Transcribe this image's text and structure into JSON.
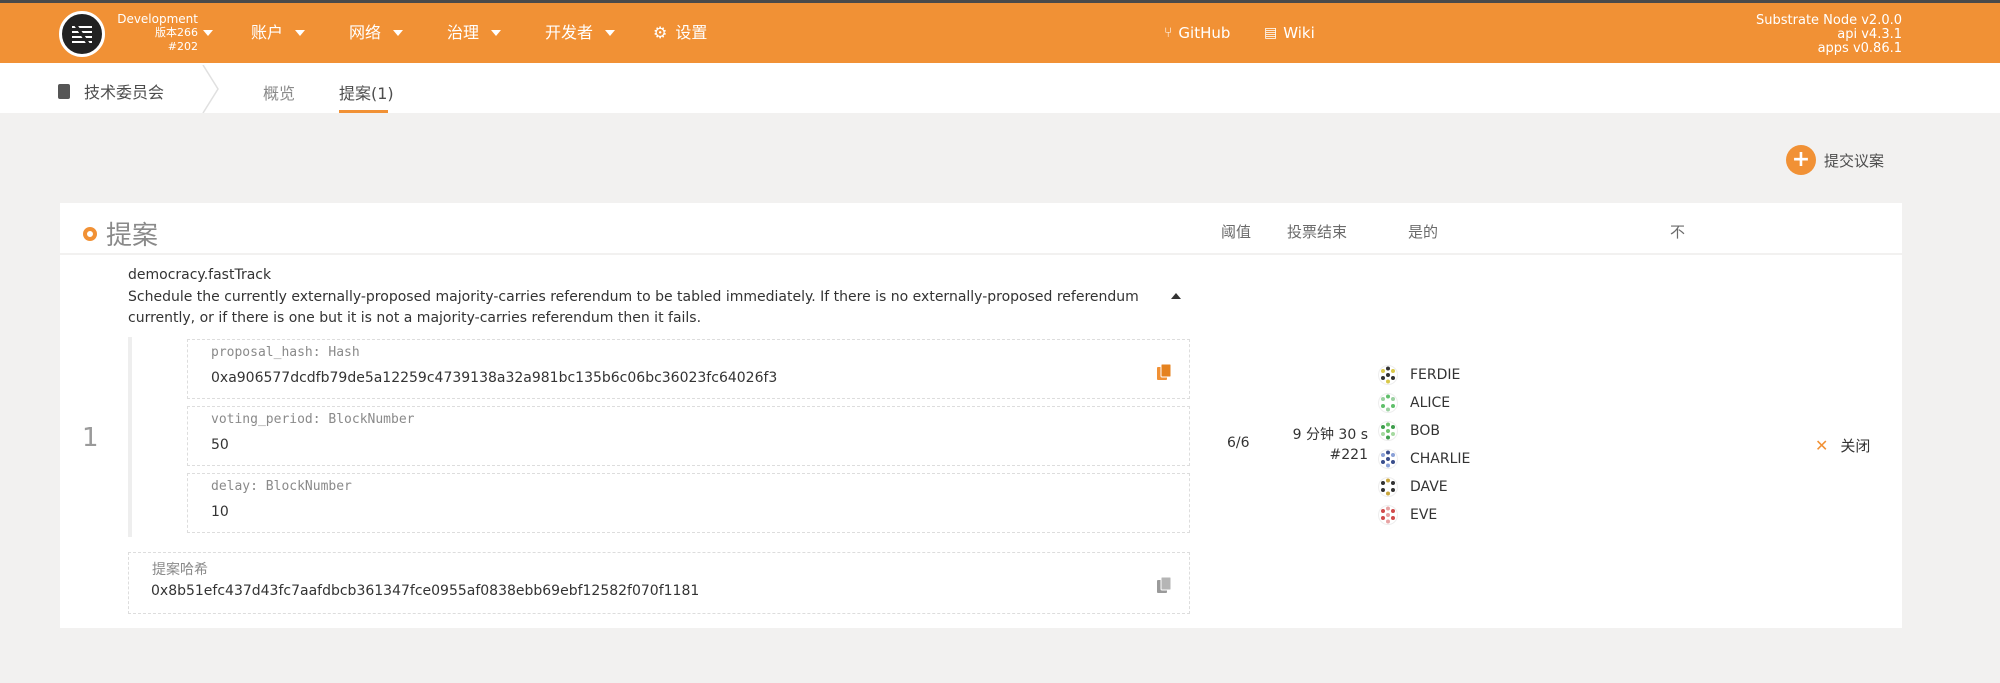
{
  "topbar": {
    "chain": "Development",
    "spec_version": "版本266",
    "best_block": "#202",
    "menu": [
      {
        "label": "账户"
      },
      {
        "label": "网络"
      },
      {
        "label": "治理"
      },
      {
        "label": "开发者"
      }
    ],
    "settings_label": "设置",
    "github_label": "GitHub",
    "wiki_label": "Wiki",
    "node_name": "Substrate Node v2.0.0",
    "api_version": "api v4.3.1",
    "apps_version": "apps v0.86.1",
    "accent_color": "#f19135"
  },
  "subnav": {
    "section": "技术委员会",
    "tabs": [
      {
        "label": "概览",
        "active": false
      },
      {
        "label": "提案(1)",
        "active": true
      }
    ]
  },
  "submit_label": "提交议案",
  "table": {
    "title": "提案",
    "columns": {
      "threshold": "阈值",
      "voting_end": "投票结束",
      "ayes": "是的",
      "nays": "不"
    },
    "rows": [
      {
        "index": "1",
        "method": "democracy.fastTrack",
        "description": "Schedule the currently externally-proposed majority-carries referendum to be tabled immediately. If there is no externally-proposed referendum currently, or if there is one but it is not a majority-carries referendum then it fails.",
        "params": [
          {
            "label": "proposal_hash: Hash",
            "value": "0xa906577dcdfb79de5a12259c4739138a32a981bc135b6c06bc36023fc64026f3"
          },
          {
            "label": "voting_period: BlockNumber",
            "value": "50"
          },
          {
            "label": "delay: BlockNumber",
            "value": "10"
          }
        ],
        "hash_label": "提案哈希",
        "hash": "0x8b51efc437d43fc7aafdbcb361347fce0955af0838ebb69ebf12582f070f1181",
        "threshold": "6/6",
        "voting_end_time": "9 分钟 30 s",
        "voting_end_block": "#221",
        "ayes": [
          "FERDIE",
          "ALICE",
          "BOB",
          "CHARLIE",
          "DAVE",
          "EVE"
        ],
        "close_label": "关闭"
      }
    ]
  }
}
